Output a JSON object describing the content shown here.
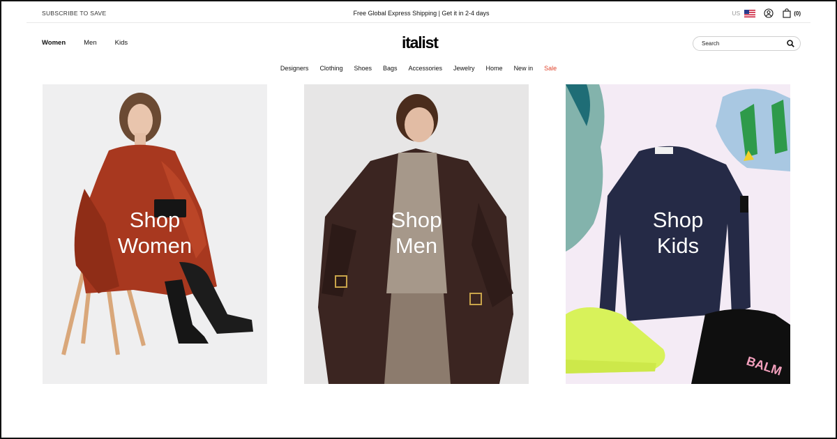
{
  "topbar": {
    "subscribe": "SUBSCRIBE TO SAVE",
    "shipping": "Free Global Express Shipping | Get it in 2-4 days",
    "country": "US",
    "cart_count": "(0)"
  },
  "header": {
    "logo": "italist",
    "gender_nav": [
      "Women",
      "Men",
      "Kids"
    ],
    "active_gender": "Women",
    "search_placeholder": "Search"
  },
  "category_nav": {
    "items": [
      "Designers",
      "Clothing",
      "Shoes",
      "Bags",
      "Accessories",
      "Jewelry",
      "Home",
      "New in"
    ],
    "sale": "Sale"
  },
  "tiles": [
    {
      "line1": "Shop",
      "line2": "Women"
    },
    {
      "line1": "Shop",
      "line2": "Men"
    },
    {
      "line1": "Shop",
      "line2": "Kids"
    }
  ],
  "icons": {
    "flag": "us-flag-icon",
    "account": "user-icon",
    "cart": "shopping-bag-icon",
    "search": "search-icon"
  },
  "colors": {
    "sale": "#e0442c",
    "text": "#111111"
  }
}
